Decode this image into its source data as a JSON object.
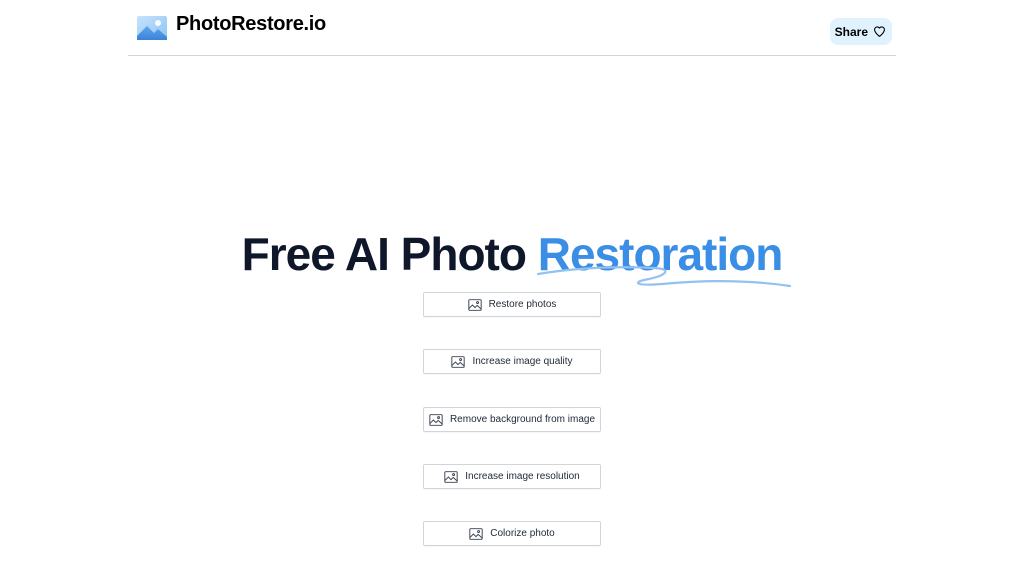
{
  "header": {
    "logo_text": "PhotoRestore.io",
    "logo_icon": "picture-icon",
    "share_label": "Share",
    "share_icon": "heart-icon"
  },
  "hero": {
    "title_main": "Free AI Photo ",
    "title_accent": "Restoration",
    "accent_color": "#3b8ee6"
  },
  "actions": [
    {
      "label": "Restore photos",
      "icon": "image-icon"
    },
    {
      "label": "Increase image quality",
      "icon": "image-icon"
    },
    {
      "label": "Remove background from image",
      "icon": "image-icon"
    },
    {
      "label": "Increase image resolution",
      "icon": "image-icon"
    },
    {
      "label": "Colorize photo",
      "icon": "image-icon"
    }
  ],
  "colors": {
    "share_bg": "#e0f2fe",
    "title_color": "#0f172a",
    "border": "#d1d5db"
  }
}
